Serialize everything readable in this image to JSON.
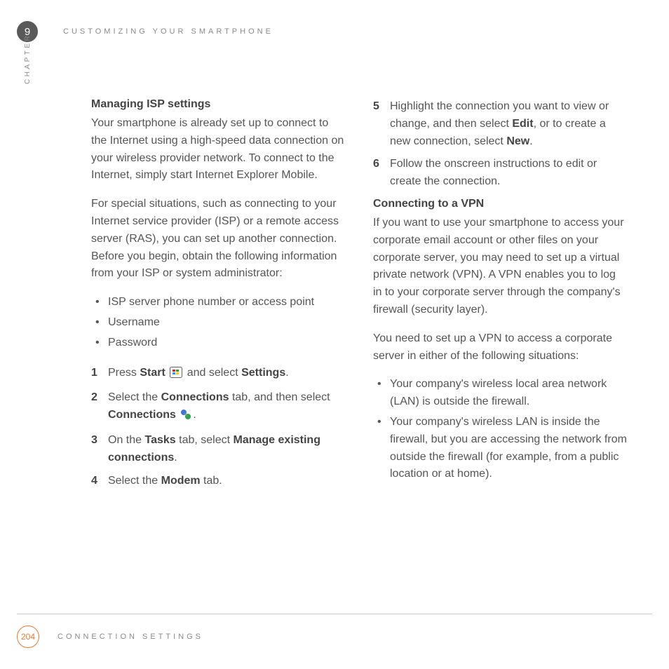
{
  "header": {
    "chapter_number": "9",
    "chapter_title": "CUSTOMIZING YOUR SMARTPHONE",
    "side_label": "CHAPTER"
  },
  "col_left": {
    "h1": "Managing ISP settings",
    "p1": "Your smartphone is already set up to connect to the Internet using a high-speed data connection on your wireless provider network. To connect to the Internet, simply start Internet Explorer Mobile.",
    "p2": "For special situations, such as connecting to your Internet service provider (ISP) or a remote access server (RAS), you can set up another connection. Before you begin, obtain the following information from your ISP or system administrator:",
    "bullets": [
      "ISP server phone number or access point",
      "Username",
      "Password"
    ],
    "steps": {
      "s1_a": "Press ",
      "s1_b": "Start",
      "s1_c": " and select ",
      "s1_d": "Settings",
      "s1_e": ".",
      "s2_a": "Select the ",
      "s2_b": "Connections",
      "s2_c": " tab, and then select ",
      "s2_d": "Connections",
      "s2_e": ".",
      "s3_a": "On the ",
      "s3_b": "Tasks",
      "s3_c": " tab, select ",
      "s3_d": "Manage existing connections",
      "s3_e": ".",
      "s4_a": "Select the ",
      "s4_b": "Modem",
      "s4_c": " tab."
    },
    "nums": {
      "n1": "1",
      "n2": "2",
      "n3": "3",
      "n4": "4"
    }
  },
  "col_right": {
    "steps": {
      "s5_a": "Highlight the connection you want to view or change, and then select ",
      "s5_b": "Edit",
      "s5_c": ", or to create a new connection, select ",
      "s5_d": "New",
      "s5_e": ".",
      "s6": "Follow the onscreen instructions to edit or create the connection."
    },
    "nums": {
      "n5": "5",
      "n6": "6"
    },
    "h2": "Connecting to a VPN",
    "p3": "If you want to use your smartphone to access your corporate email account or other files on your corporate server, you may need to set up a virtual private network (VPN). A VPN enables you to log in to your corporate server through the company's firewall (security layer).",
    "p4": "You need to set up a VPN to access a corporate server in either of the following situations:",
    "bullets": [
      "Your company's wireless local area network (LAN) is outside the firewall.",
      "Your company's wireless LAN is inside the firewall, but you are accessing the network from outside the firewall (for example, from a public location or at home)."
    ]
  },
  "footer": {
    "page_number": "204",
    "section_title": "CONNECTION SETTINGS"
  }
}
